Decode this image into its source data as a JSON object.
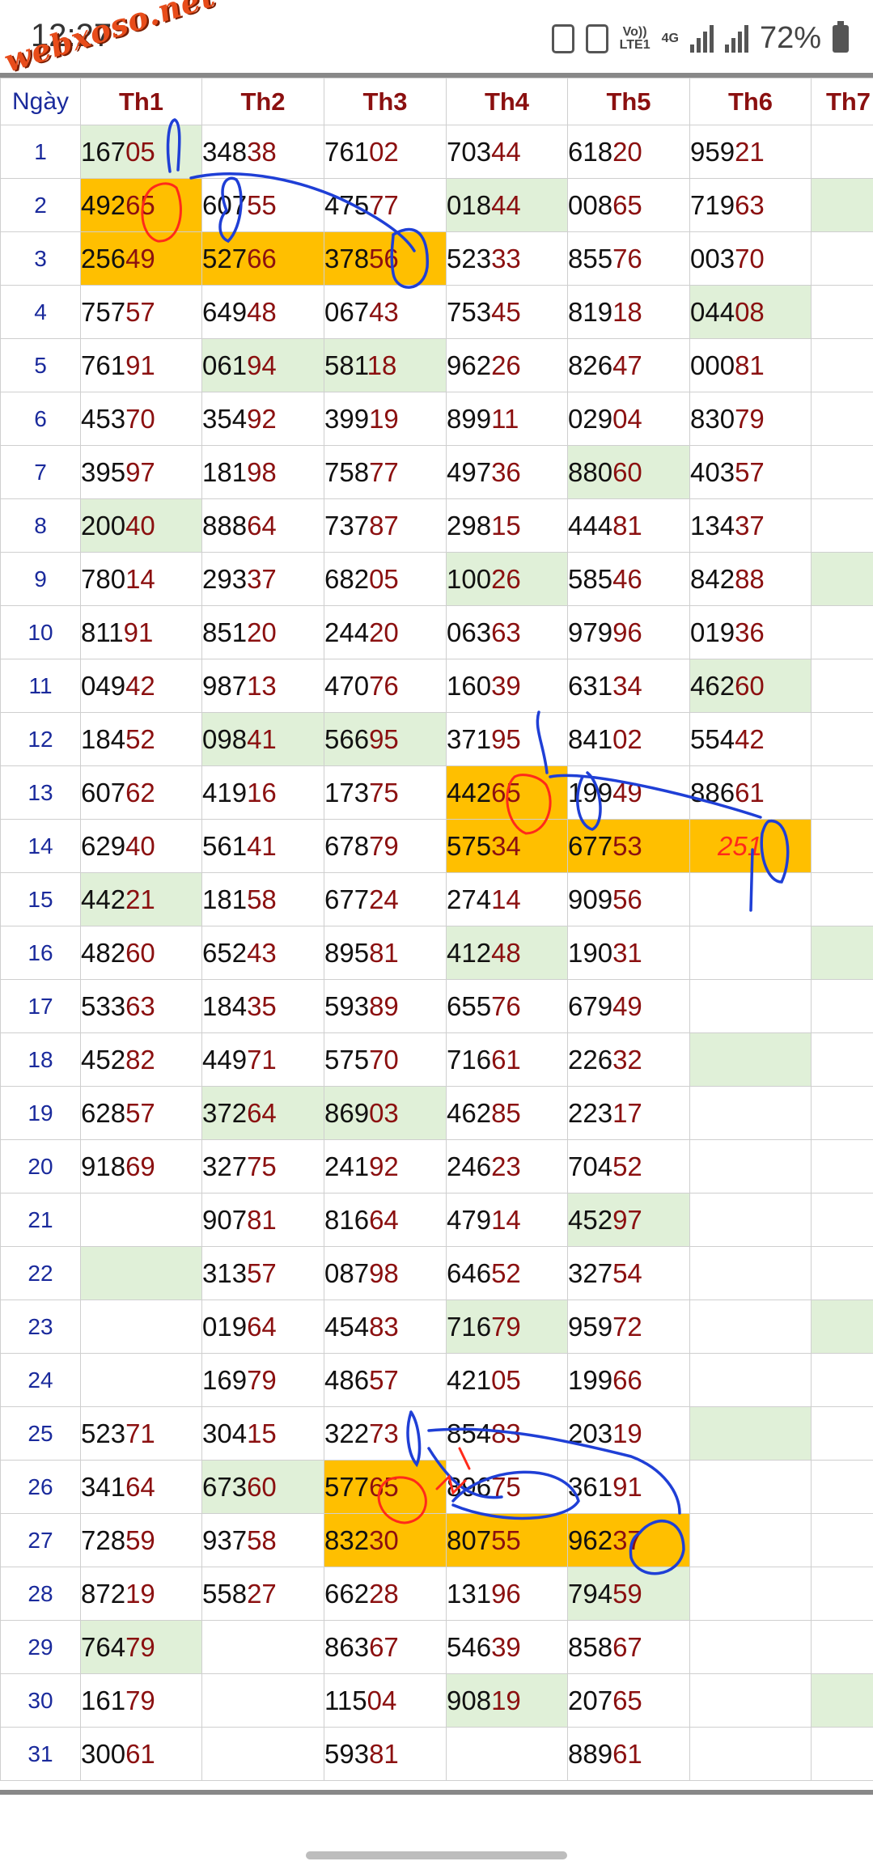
{
  "status_bar": {
    "time": "12:27",
    "watermark": "webxoso.net",
    "network_top": "Vo))",
    "network_bottom": "LTE1",
    "network_gen": "4G",
    "battery": "72%"
  },
  "table": {
    "headers": [
      "Ngày",
      "Th1",
      "Th2",
      "Th3",
      "Th4",
      "Th5",
      "Th6",
      "Th7"
    ],
    "rows": [
      {
        "day": "1",
        "cells": [
          "16705",
          "34838",
          "76102",
          "70344",
          "61820",
          "95921",
          ""
        ]
      },
      {
        "day": "2",
        "cells": [
          "49265",
          "60755",
          "47577",
          "01844",
          "00865",
          "71963",
          ""
        ]
      },
      {
        "day": "3",
        "cells": [
          "25649",
          "52766",
          "37856",
          "52333",
          "85576",
          "00370",
          ""
        ]
      },
      {
        "day": "4",
        "cells": [
          "75757",
          "64948",
          "06743",
          "75345",
          "81918",
          "04408",
          ""
        ]
      },
      {
        "day": "5",
        "cells": [
          "76191",
          "06194",
          "58118",
          "96226",
          "82647",
          "00081",
          ""
        ]
      },
      {
        "day": "6",
        "cells": [
          "45370",
          "35492",
          "39919",
          "89911",
          "02904",
          "83079",
          ""
        ]
      },
      {
        "day": "7",
        "cells": [
          "39597",
          "18198",
          "75877",
          "49736",
          "88060",
          "40357",
          ""
        ]
      },
      {
        "day": "8",
        "cells": [
          "20040",
          "88864",
          "73787",
          "29815",
          "44481",
          "13437",
          ""
        ]
      },
      {
        "day": "9",
        "cells": [
          "78014",
          "29337",
          "68205",
          "10026",
          "58546",
          "84288",
          ""
        ]
      },
      {
        "day": "10",
        "cells": [
          "81191",
          "85120",
          "24420",
          "06363",
          "97996",
          "01936",
          ""
        ]
      },
      {
        "day": "11",
        "cells": [
          "04942",
          "98713",
          "47076",
          "16039",
          "63134",
          "46260",
          ""
        ]
      },
      {
        "day": "12",
        "cells": [
          "18452",
          "09841",
          "56695",
          "37195",
          "84102",
          "55442",
          ""
        ]
      },
      {
        "day": "13",
        "cells": [
          "60762",
          "41916",
          "17375",
          "44265",
          "19949",
          "88661",
          ""
        ]
      },
      {
        "day": "14",
        "cells": [
          "62940",
          "56141",
          "67879",
          "57534",
          "67753",
          "251",
          ""
        ]
      },
      {
        "day": "15",
        "cells": [
          "44221",
          "18158",
          "67724",
          "27414",
          "90956",
          "",
          ""
        ]
      },
      {
        "day": "16",
        "cells": [
          "48260",
          "65243",
          "89581",
          "41248",
          "19031",
          "",
          ""
        ]
      },
      {
        "day": "17",
        "cells": [
          "53363",
          "18435",
          "59389",
          "65576",
          "67949",
          "",
          ""
        ]
      },
      {
        "day": "18",
        "cells": [
          "45282",
          "44971",
          "57570",
          "71661",
          "22632",
          "",
          ""
        ]
      },
      {
        "day": "19",
        "cells": [
          "62857",
          "37264",
          "86903",
          "46285",
          "22317",
          "",
          ""
        ]
      },
      {
        "day": "20",
        "cells": [
          "91869",
          "32775",
          "24192",
          "24623",
          "70452",
          "",
          ""
        ]
      },
      {
        "day": "21",
        "cells": [
          "",
          "90781",
          "81664",
          "47914",
          "45297",
          "",
          ""
        ]
      },
      {
        "day": "22",
        "cells": [
          "",
          "31357",
          "08798",
          "64652",
          "32754",
          "",
          ""
        ]
      },
      {
        "day": "23",
        "cells": [
          "",
          "01964",
          "45483",
          "71679",
          "95972",
          "",
          ""
        ]
      },
      {
        "day": "24",
        "cells": [
          "",
          "16979",
          "48657",
          "42105",
          "19966",
          "",
          ""
        ]
      },
      {
        "day": "25",
        "cells": [
          "52371",
          "30415",
          "32273",
          "85483",
          "20319",
          "",
          ""
        ]
      },
      {
        "day": "26",
        "cells": [
          "34164",
          "67360",
          "57765",
          "89675",
          "36191",
          "",
          ""
        ]
      },
      {
        "day": "27",
        "cells": [
          "72859",
          "93758",
          "83230",
          "80755",
          "96237",
          "",
          ""
        ]
      },
      {
        "day": "28",
        "cells": [
          "87219",
          "55827",
          "66228",
          "13196",
          "79459",
          "",
          ""
        ]
      },
      {
        "day": "29",
        "cells": [
          "76479",
          "",
          "86367",
          "54639",
          "85867",
          "",
          ""
        ]
      },
      {
        "day": "30",
        "cells": [
          "16179",
          "",
          "11504",
          "90819",
          "20765",
          "",
          ""
        ]
      },
      {
        "day": "31",
        "cells": [
          "30061",
          "",
          "59381",
          "",
          "88961",
          "",
          ""
        ]
      }
    ],
    "highlights": {
      "green": [
        "1-0",
        "8-0",
        "15-0",
        "22-0",
        "29-0",
        "5-1",
        "12-1",
        "19-1",
        "26-1",
        "5-2",
        "12-2",
        "19-2",
        "2-3",
        "9-3",
        "16-3",
        "23-3",
        "30-3",
        "7-4",
        "21-4",
        "28-4",
        "4-5",
        "11-5",
        "18-5",
        "25-5",
        "2-6",
        "9-6",
        "16-6",
        "23-6",
        "30-6"
      ],
      "orange": [
        "2-0",
        "3-0",
        "3-1",
        "3-2",
        "13-3",
        "14-3",
        "14-4",
        "14-5",
        "26-2",
        "27-2",
        "27-3",
        "27-4"
      ]
    },
    "colors": {
      "green": "#e0f0d8",
      "orange": "#ffbf00",
      "day_blue": "#1a2a9c",
      "digit_red": "#8b1010",
      "ink_blue": "#1f3fd6",
      "ink_red": "#ff2a1a"
    }
  }
}
